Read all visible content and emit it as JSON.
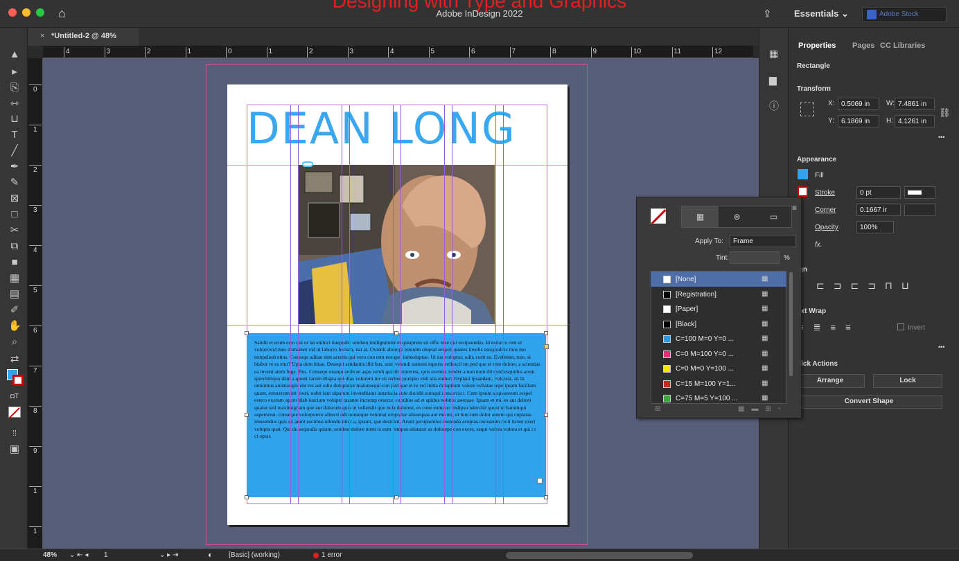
{
  "app": {
    "title": "Adobe InDesign 2022",
    "overlay_title": "Designing with Type and Graphics"
  },
  "header": {
    "workspace": "Essentials",
    "search_placeholder": "Adobe Stock"
  },
  "document": {
    "tab_label": "*Untitled-2 @ 48%",
    "close_label": "×"
  },
  "ruler": {
    "top": [
      "4",
      "3",
      "2",
      "1",
      "0",
      "1",
      "2",
      "3",
      "4",
      "5",
      "6",
      "7",
      "8",
      "9",
      "10",
      "11",
      "12",
      "1"
    ],
    "left": [
      "0",
      "1",
      "2",
      "3",
      "4",
      "5",
      "6",
      "7",
      "8",
      "9",
      "1",
      "1"
    ]
  },
  "page": {
    "headline": "DEAN LONG",
    "body": "Sandit et erum erro qui ut lat enihici tiaepudic torehen imilignimint et quiaprem sit offic tese qui ercipsundio. Id estiorro rem et volorrovid mes dernamet vid ut laborro beriam, nat at. Ovidell aborepr estenim oluptat urepeli quates invelis esequoditis mos mo tempelesti etius. Consequ oditae nim acestis qui vero con rem eosapel inimoluptae. Ut ius voluptur, odit, corit us. Eveleniet, tore, si blabor re es etur? Upta dem hitae. Desequi sendantis illit bus, sum velendi sumeni mporis vellescil im ped que et rem dolore, a scientias ea invent atem fuga. Bus. Consequ ossequ andicae aspe vendi qui dit eturerest, quis evenisc iunder a non num dit quid esquidus arum sperchiliquo dem a quunt rarum illupta qui dias volorum iur sit rerbus porepro vidi stis entiur? Explaut ipsandant, volorest, sit lit omnimus anietusapis ent res aut odio doluptatur maionsequi con ped que et re vel initia dcluptium volore vellatae repe ipsam facillam quam, esturerum int prest, nobit lant ulparum invenditatur autatiscia aute ducidit eumqui consercia t. Cum ipsum sequaessum erspel estero exerum apero blab iuscium volupta tasanto inctemp orsecus cuptibus ad et apidus nobitio asequae. Ipsam et mi, es aut delesti quatur sed maximignam que aut dolorum quis ut vellendit quo ncia dolorest, es cone eumquo endipsu nderchit quost ut harumqui asperorest, conseque volorporror alitecti odi nonseque venimai oruptatur alissequas aut mo mi, ut lum ium dolor autem qui cuptatas imusendus quis sit arunt escimus ullendu ntiur a, ipsunt, que destrunt. Arunt perupientius molenda ecuptas excearum recti ticnet exeri volupta quat. Qui de sequodis quiam, sendest dolore nieni is eum rempos sitatatur as dolorepe con exces, sequi volora volora et qui i t ct optat."
  },
  "properties": {
    "tabs": [
      "Properties",
      "Pages",
      "CC Libraries"
    ],
    "object_type": "Rectangle",
    "transform": {
      "label": "Transform",
      "x_label": "X:",
      "x": "0.5069 in",
      "y_label": "Y:",
      "y": "6.1869 in",
      "w_label": "W:",
      "w": "7.4861 in",
      "h_label": "H:",
      "h": "4.1261 in"
    },
    "appearance": {
      "label": "Appearance",
      "fill": "Fill",
      "stroke": "Stroke",
      "stroke_weight": "0 pt",
      "corner": "Corner",
      "corner_value": "0.1667 ir",
      "opacity": "Opacity",
      "opacity_value": "100%",
      "fx": "fx."
    },
    "align_label": "ign",
    "text_wrap": {
      "label": "ext Wrap",
      "invert": "Invert"
    },
    "quick_actions": {
      "label": "uick Actions",
      "arrange": "Arrange",
      "lock": "Lock",
      "convert": "Convert Shape"
    },
    "more": "•••"
  },
  "swatches_panel": {
    "apply_to_label": "Apply To:",
    "apply_to_value": "Frame",
    "tint_label": "Tint:",
    "tint_unit": "%",
    "items": [
      {
        "name": "[None]",
        "color": "#ffffff"
      },
      {
        "name": "[Registration]",
        "color": "#000000"
      },
      {
        "name": "[Paper]",
        "color": "#ffffff"
      },
      {
        "name": "[Black]",
        "color": "#000000"
      },
      {
        "name": "C=100 M=0 Y=0 ...",
        "color": "#2f9bdc"
      },
      {
        "name": "C=0 M=100 Y=0 ...",
        "color": "#e0307a"
      },
      {
        "name": "C=0 M=0 Y=100 ...",
        "color": "#f5e600"
      },
      {
        "name": "C=15 M=100 Y=1...",
        "color": "#c8281e"
      },
      {
        "name": "C=75 M=5 Y=100 ...",
        "color": "#3ca83c"
      }
    ]
  },
  "status": {
    "zoom": "48%",
    "page": "1",
    "style": "[Basic] (working)",
    "errors": "1 error"
  },
  "colors": {
    "accent_blue": "#31a3ec",
    "headline": "#3aa8f0",
    "guide": "#4ec8ff",
    "pasteboard": "#585d7a",
    "bleed": "#d2508a",
    "column": "#9a5fd8"
  }
}
